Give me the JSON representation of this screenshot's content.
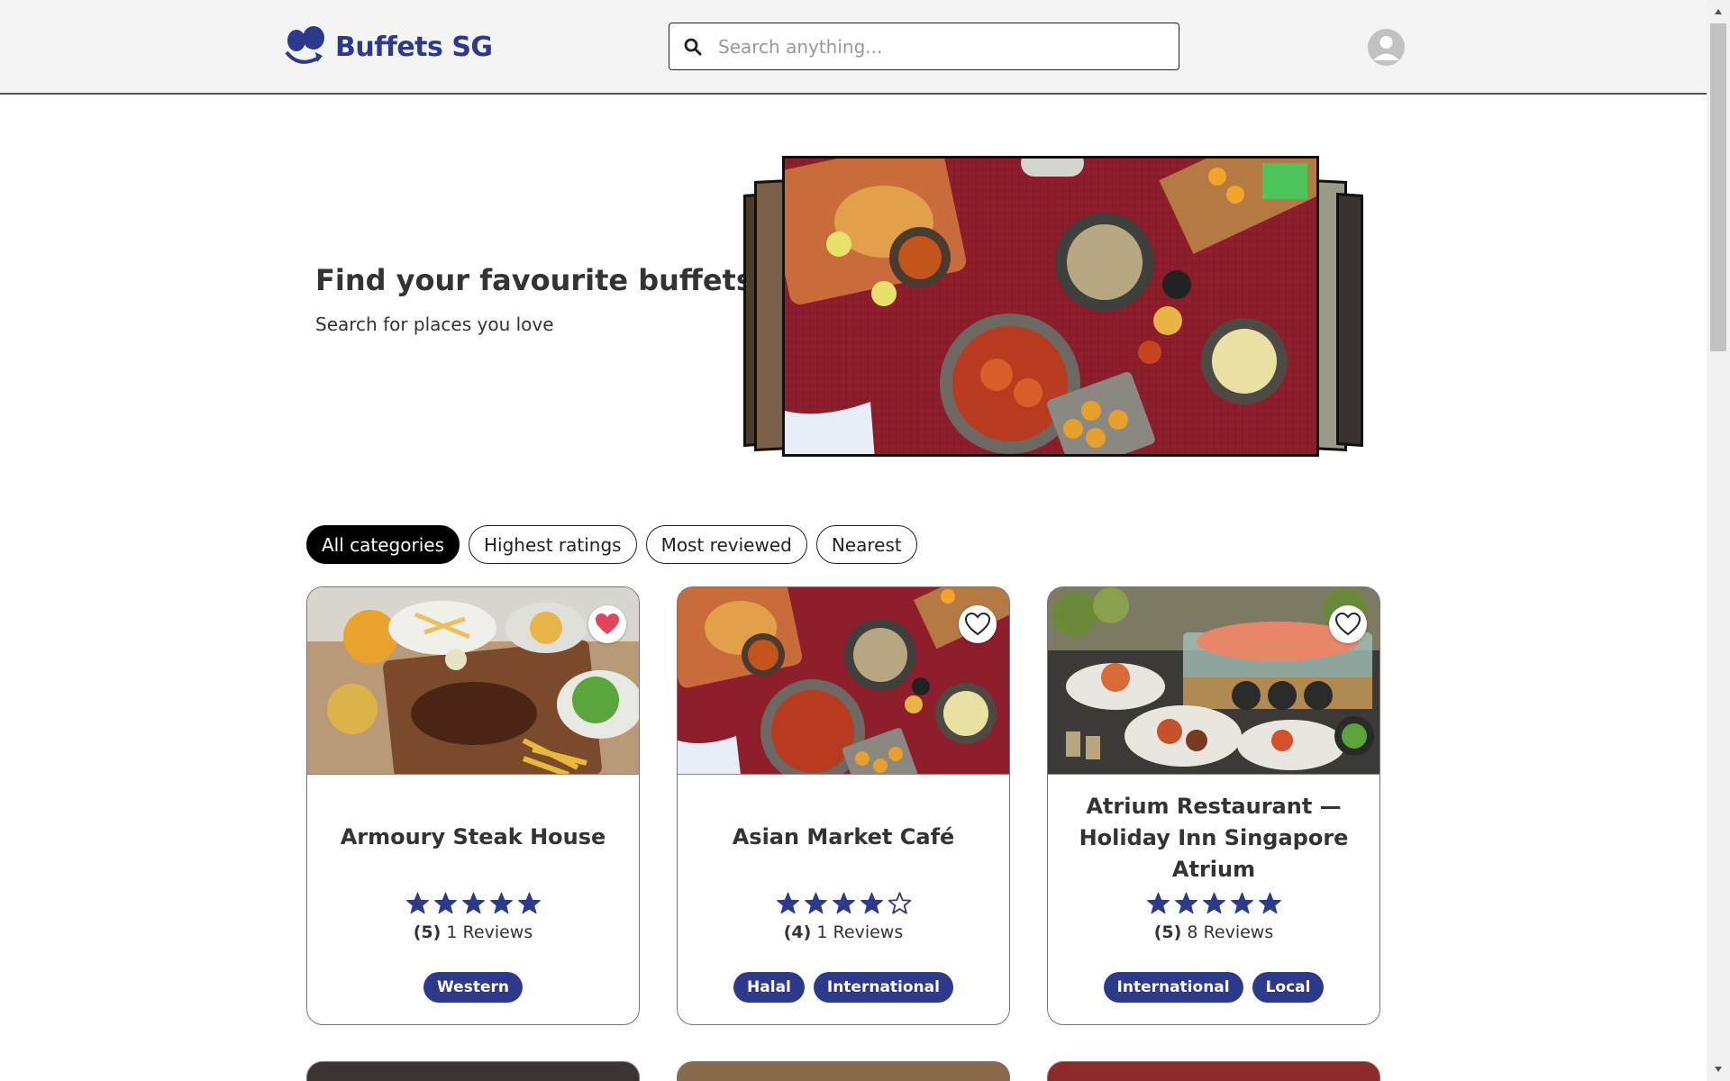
{
  "header": {
    "brand": "Buffets SG",
    "search_placeholder": "Search anything...",
    "search_value": ""
  },
  "hero": {
    "title": "Find your favourite buffets",
    "subtitle": "Search for places you love"
  },
  "filters": [
    {
      "label": "All categories",
      "active": true
    },
    {
      "label": "Highest ratings",
      "active": false
    },
    {
      "label": "Most reviewed",
      "active": false
    },
    {
      "label": "Nearest",
      "active": false
    }
  ],
  "cards": [
    {
      "name": "Armoury Steak House",
      "rating": 5,
      "rating_label": "(5)",
      "review_count": "1",
      "reviews_word": "Reviews",
      "tags": [
        "Western"
      ],
      "favourited": true
    },
    {
      "name": "Asian Market Café",
      "rating": 4,
      "rating_label": "(4)",
      "review_count": "1",
      "reviews_word": "Reviews",
      "tags": [
        "Halal",
        "International"
      ],
      "favourited": false
    },
    {
      "name": "Atrium Restaurant — Holiday Inn Singapore Atrium",
      "rating": 5,
      "rating_label": "(5)",
      "review_count": "8",
      "reviews_word": "Reviews",
      "tags": [
        "International",
        "Local"
      ],
      "favourited": false
    }
  ],
  "colors": {
    "brand": "#2d3a8c",
    "star": "#2d3a8c",
    "favourite": "#e0455a",
    "header_bg": "#f4f4f4"
  }
}
